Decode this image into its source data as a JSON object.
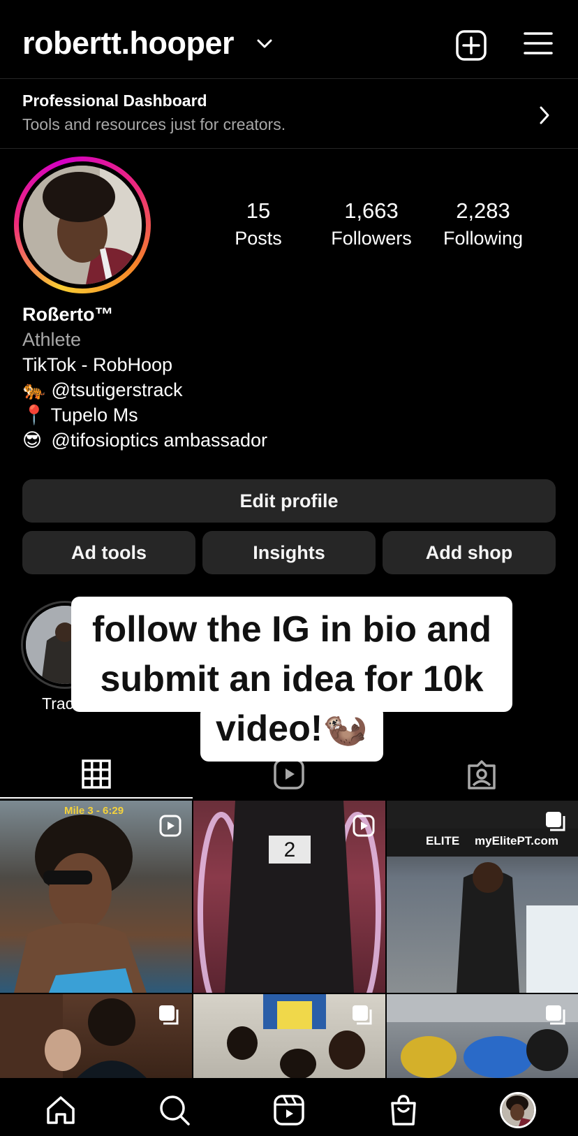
{
  "header": {
    "username": "robertt.hooper",
    "icons": [
      "chevron-down-icon",
      "new-post-icon",
      "hamburger-menu-icon"
    ]
  },
  "dashboard": {
    "title": "Professional Dashboard",
    "subtitle": "Tools and resources just for creators."
  },
  "stats": {
    "posts": {
      "value": "15",
      "label": "Posts"
    },
    "followers": {
      "value": "1,663",
      "label": "Followers"
    },
    "following": {
      "value": "2,283",
      "label": "Following"
    }
  },
  "bio": {
    "name": "Roßerto™",
    "category": "Athlete",
    "line1": "TikTok - RobHoop",
    "line2_emoji": "🐅",
    "line2": "@tsutigerstrack",
    "line3_emoji": "📍",
    "line3": "Tupelo Ms",
    "line4_emoji": "😎",
    "line4": "@tifosioptics ambassador"
  },
  "buttons": {
    "edit_profile": "Edit profile",
    "ad_tools": "Ad tools",
    "insights": "Insights",
    "add_shop": "Add shop"
  },
  "highlight": {
    "label": "Trac"
  },
  "caption_overlay": {
    "line1": "follow the IG in bio and",
    "line2": "submit an idea for 10k",
    "line3": "video!🦦"
  },
  "tabs": [
    "grid-icon",
    "reels-icon",
    "tagged-icon"
  ],
  "grid": {
    "post1_overlay": "Mile 3 - 6:29",
    "post3_banner_left": "ELITE",
    "post3_banner_right": "myElitePT.com"
  },
  "nav": [
    "home-icon",
    "search-icon",
    "reels-icon",
    "shop-icon",
    "profile-avatar"
  ],
  "colors": {
    "background": "#000000",
    "button": "#262626",
    "secondary_text": "#a8a8a8"
  }
}
